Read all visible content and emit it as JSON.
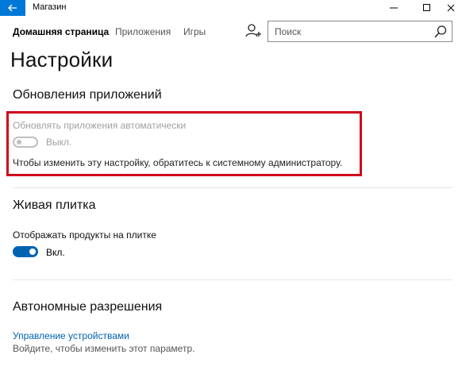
{
  "window": {
    "title": "Магазин",
    "back_icon": "arrow-left-icon",
    "minimize_icon": "minimize-icon",
    "maximize_icon": "maximize-icon",
    "close_icon": "close-icon",
    "accent": "#0078d7"
  },
  "nav": {
    "home": "Домашняя страница",
    "apps": "Приложения",
    "games": "Игры",
    "user_icon": "user-add-icon",
    "search_placeholder": "Поиск",
    "search_icon": "search-icon"
  },
  "page": {
    "title": "Настройки"
  },
  "app_updates": {
    "header": "Обновления приложений",
    "toggle_label": "Обновлять приложения автоматически",
    "toggle_state": "Выкл.",
    "toggle_on": false,
    "disabled": true,
    "admin_note": "Чтобы изменить эту настройку, обратитесь к системному администратору.",
    "highlight_color": "#d0021b"
  },
  "live_tile": {
    "header": "Живая плитка",
    "toggle_label": "Отображать продукты на плитке",
    "toggle_state": "Вкл.",
    "toggle_on": true,
    "toggle_color": "#0063b1"
  },
  "offline": {
    "header": "Автономные разрешения",
    "link": "Управление устройствами",
    "hint": "Войдите, чтобы изменить этот параметр."
  }
}
